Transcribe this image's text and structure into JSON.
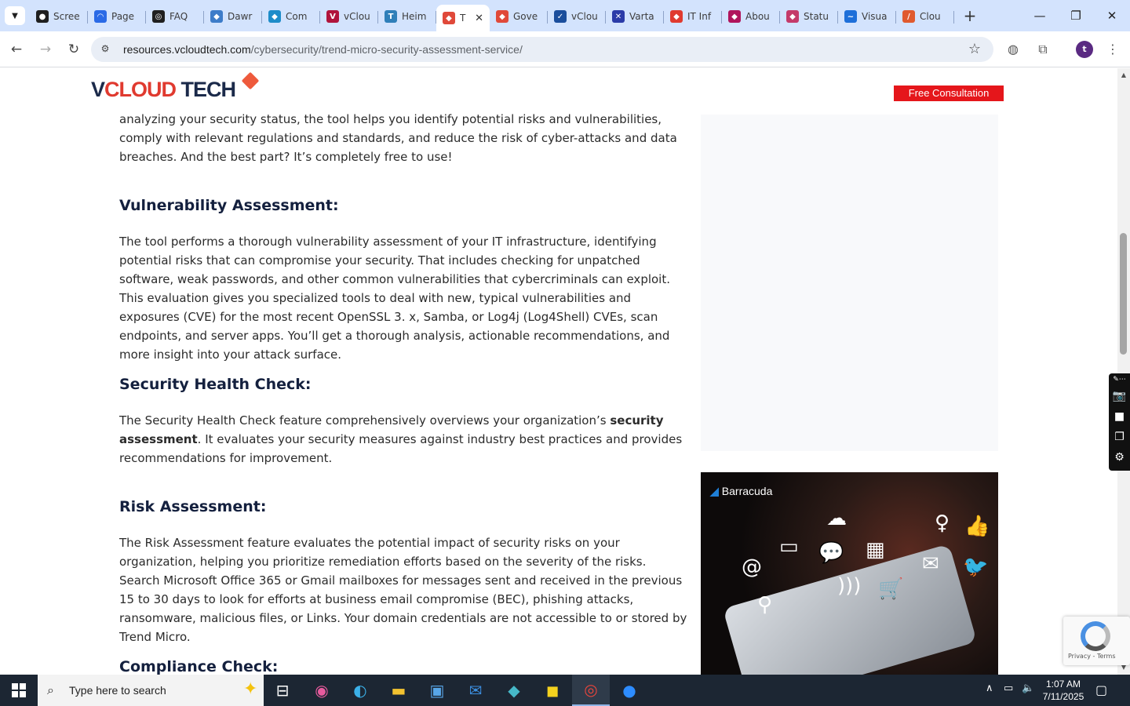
{
  "browser": {
    "tabs": [
      {
        "title": "Scree",
        "color": "#1f1f1f",
        "glyph": "●"
      },
      {
        "title": "Page",
        "color": "#2a6ae6",
        "glyph": "◠"
      },
      {
        "title": "FAQ",
        "color": "#1f1f1f",
        "glyph": "◎"
      },
      {
        "title": "Dawr",
        "color": "#3d7cc9",
        "glyph": "◆"
      },
      {
        "title": "Com",
        "color": "#1d8cc9",
        "glyph": "◆"
      },
      {
        "title": "vClou",
        "color": "#b0143c",
        "glyph": "V"
      },
      {
        "title": "Heim",
        "color": "#2f7fb9",
        "glyph": "T"
      },
      {
        "title": "T",
        "color": "#e0493a",
        "glyph": "◆",
        "active": true
      },
      {
        "title": "Gove",
        "color": "#e0493a",
        "glyph": "◆"
      },
      {
        "title": "vClou",
        "color": "#1b4e9c",
        "glyph": "✓"
      },
      {
        "title": "Varta",
        "color": "#2b3ba8",
        "glyph": "✕"
      },
      {
        "title": "IT Inf",
        "color": "#e03a2f",
        "glyph": "◆"
      },
      {
        "title": "Abou",
        "color": "#b0145c",
        "glyph": "◆"
      },
      {
        "title": "Statu",
        "color": "#c43a6a",
        "glyph": "◆"
      },
      {
        "title": "Visua",
        "color": "#1e6fd9",
        "glyph": "~"
      },
      {
        "title": "Clou",
        "color": "#e05a2f",
        "glyph": "/"
      }
    ],
    "new_tab": "+",
    "minimize": "—",
    "maximize": "❐",
    "close": "✕",
    "url_host": "resources.vcloudtech.com",
    "url_path": "/cybersecurity/trend-micro-security-assessment-service/",
    "profile_initial": "t"
  },
  "site": {
    "logo_v": "V",
    "logo_cloud": "CLOUD",
    "logo_tech": " TECH",
    "cta": "Free Consultation"
  },
  "article": {
    "intro": "analyzing your security status, the tool helps you identify potential risks and vulnerabilities, comply with relevant regulations and standards, and reduce the risk of cyber-attacks and data breaches. And the best part? It’s completely free to use!",
    "h_vuln": "Vulnerability Assessment:",
    "p_vuln": "The tool performs a thorough vulnerability assessment of your IT infrastructure, identifying potential risks that can compromise your security. That includes checking for unpatched software, weak passwords, and other common vulnerabilities that cybercriminals can exploit. This evaluation gives you specialized tools to deal with new, typical vulnerabilities and exposures (CVE) for the most recent OpenSSL 3. x, Samba, or Log4j (Log4Shell) CVEs, scan endpoints, and server apps. You’ll get a thorough analysis, actionable recommendations, and more insight into your attack surface.",
    "h_health": "Security Health Check:",
    "p_health_a": "The Security Health Check feature comprehensively overviews your organization’s ",
    "p_health_b": "security assessment",
    "p_health_c": ". It evaluates your security measures against industry best practices and provides recommendations for improvement.",
    "h_risk": "Risk Assessment:",
    "p_risk": "The Risk Assessment feature evaluates the potential impact of security risks on your organization, helping you prioritize remediation efforts based on the severity of the risks. Search Microsoft Office 365 or Gmail mailboxes for messages sent and received in the previous 15 to 30 days to look for efforts at business email compromise (BEC), phishing attacks, ransomware, malicious files, or Links. Your domain credentials are not accessible to or stored by Trend Micro.",
    "h_compliance": "Compliance Check:"
  },
  "promo": {
    "brand": "Barracuda"
  },
  "recaptcha": {
    "links": "Privacy - Terms"
  },
  "taskbar": {
    "search_placeholder": "Type here to search",
    "time": "1:07 AM",
    "date": "7/11/2025"
  }
}
